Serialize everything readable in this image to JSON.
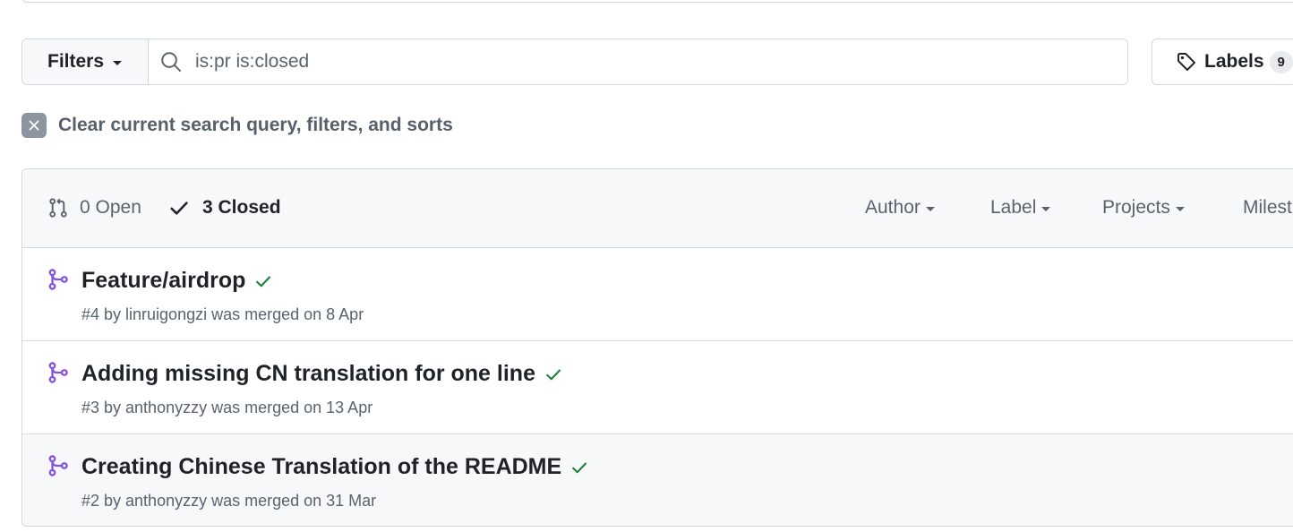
{
  "filters": {
    "button_label": "Filters",
    "search_value": "is:pr is:closed"
  },
  "labels_button": {
    "label": "Labels",
    "count": "9"
  },
  "clear_query": {
    "text": "Clear current search query, filters, and sorts"
  },
  "list_header": {
    "open_label": "0 Open",
    "closed_label": "3 Closed",
    "filters": [
      "Author",
      "Label",
      "Projects",
      "Milest"
    ]
  },
  "pull_requests": [
    {
      "title": "Feature/airdrop",
      "meta": "#4 by linruigongzi was merged on 8 Apr"
    },
    {
      "title": "Adding missing CN translation for one line",
      "meta": "#3 by anthonyzzy was merged on 13 Apr"
    },
    {
      "title": "Creating Chinese Translation of the README",
      "meta": "#2 by anthonyzzy was merged on 31 Mar"
    }
  ],
  "colors": {
    "merged_purple": "#8250df",
    "success_green": "#1a7f37",
    "border": "#d0d7de",
    "muted_text": "#59636e"
  }
}
